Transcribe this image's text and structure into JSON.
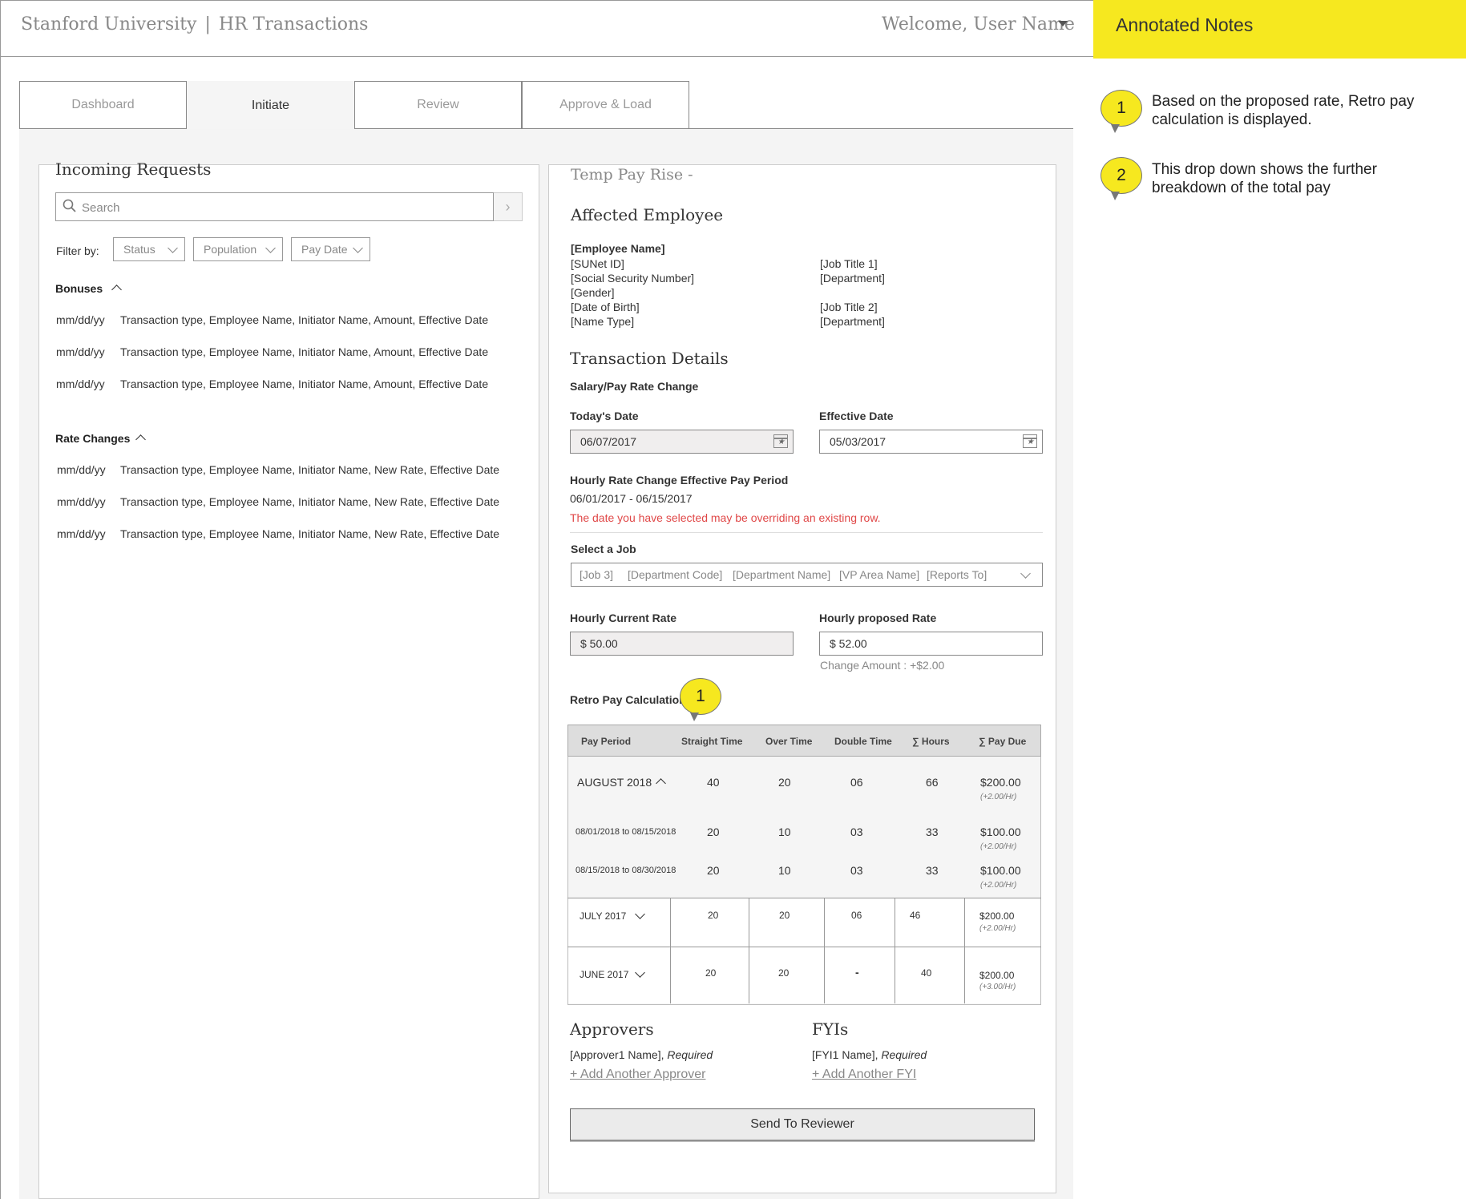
{
  "header": {
    "org": "Stanford University",
    "separator": "|",
    "app": "HR Transactions",
    "welcome": "Welcome, User Name"
  },
  "notes": {
    "title": "Annotated Notes",
    "items": [
      {
        "number": "1",
        "line1": "Based on the proposed rate, Retro pay",
        "line2": "calculation is displayed."
      },
      {
        "number": "2",
        "line1": "This drop down shows the further",
        "line2": "breakdown of the total pay"
      }
    ]
  },
  "tabs": [
    "Dashboard",
    "Initiate",
    "Review",
    "Approve & Load"
  ],
  "incoming": {
    "title": "Incoming Requests",
    "search_placeholder": "Search",
    "filter_label": "Filter by:",
    "filters": [
      "Status",
      "Population",
      "Pay Date"
    ],
    "bonuses": {
      "title": "Bonuses",
      "items": [
        {
          "date": "mm/dd/yy",
          "text": "Transaction type, Employee Name, Initiator Name, Amount, Effective Date"
        },
        {
          "date": "mm/dd/yy",
          "text": "Transaction type, Employee Name, Initiator Name, Amount, Effective Date"
        },
        {
          "date": "mm/dd/yy",
          "text": "Transaction type, Employee Name, Initiator Name, Amount, Effective Date"
        }
      ]
    },
    "rate_changes": {
      "title": "Rate Changes",
      "items": [
        {
          "date": "mm/dd/yy",
          "text": "Transaction type, Employee Name, Initiator Name, New Rate, Effective Date"
        },
        {
          "date": "mm/dd/yy",
          "text": "Transaction type, Employee Name, Initiator Name, New Rate, Effective Date"
        },
        {
          "date": "mm/dd/yy",
          "text": "Transaction type, Employee Name, Initiator Name, New Rate, Effective Date"
        }
      ]
    }
  },
  "form": {
    "title": "Temp Pay Rise -",
    "affected_employee": {
      "title": "Affected Employee",
      "name": "[Employee Name]",
      "left": [
        "[SUNet ID]",
        "[Social Security Number]",
        "[Gender]",
        "[Date of Birth]",
        "[Name Type]"
      ],
      "right": [
        "[Job Title 1]",
        "[Department]",
        "[Job Title 2]",
        "[Department]"
      ]
    },
    "transaction": {
      "title": "Transaction Details",
      "subtitle": "Salary/Pay Rate Change",
      "todays_date_label": "Today's Date",
      "todays_date": "06/07/2017",
      "effective_date_label": "Effective Date",
      "effective_date": "05/03/2017",
      "period_label": "Hourly Rate Change Effective Pay Period",
      "period": "06/01/2017 - 06/15/2017",
      "warning": "The date you have selected may be overriding an existing row.",
      "select_job_label": "Select a Job",
      "job_fields": [
        "[Job 3]",
        "[Department Code]",
        "[Department Name]",
        "[VP Area Name]",
        "[Reports To]"
      ],
      "current_rate_label": "Hourly Current  Rate",
      "current_rate": "$ 50.00",
      "proposed_rate_label": "Hourly proposed Rate",
      "proposed_rate": "$ 52.00",
      "change_amount": "Change Amount : +$2.00"
    },
    "retro": {
      "title": "Retro Pay Calculation",
      "headers": [
        "Pay Period",
        "Straight Time",
        "Over Time",
        "Double Time",
        "Hours",
        "Pay Due"
      ],
      "sigma": "∑",
      "august": {
        "period": "AUGUST 2018",
        "st": "40",
        "ot": "20",
        "dt": "06",
        "hours": "66",
        "pay": "$200.00",
        "note": "(+2.00/Hr)"
      },
      "aug_rows": [
        {
          "period": "08/01/2018 to 08/15/2018",
          "st": "20",
          "ot": "10",
          "dt": "03",
          "hours": "33",
          "pay": "$100.00",
          "note": "(+2.00/Hr)"
        },
        {
          "period": "08/15/2018 to 08/30/2018",
          "st": "20",
          "ot": "10",
          "dt": "03",
          "hours": "33",
          "pay": "$100.00",
          "note": "(+2.00/Hr)"
        }
      ],
      "july": {
        "period": "JULY 2017",
        "st": "20",
        "ot": "20",
        "dt": "06",
        "hours": "46",
        "pay": "$200.00",
        "note": "(+2.00/Hr)"
      },
      "june": {
        "period": "JUNE 2017",
        "st": "20",
        "ot": "20",
        "dt": "-",
        "hours": "40",
        "pay": "$200.00",
        "note": "(+3.00/Hr)"
      }
    },
    "approvers": {
      "title": "Approvers",
      "name": "[Approver1 Name],",
      "required": "Required",
      "add": "+ Add Another Approver"
    },
    "fyis": {
      "title": "FYIs",
      "name": "[FYI1 Name],",
      "required": "Required",
      "add": "+ Add Another FYI"
    },
    "send_label": "Send To Reviewer"
  }
}
